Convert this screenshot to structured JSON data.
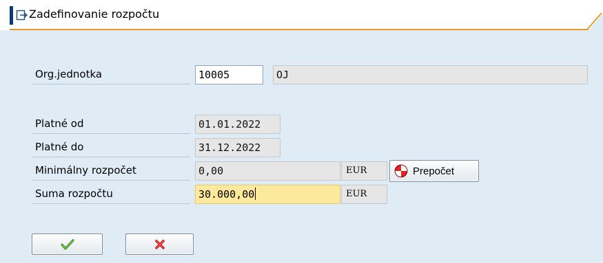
{
  "window": {
    "title": "Zadefinovanie rozpočtu",
    "colors": {
      "title_accent": "#0a3d72",
      "title_underline": "#e59a2c",
      "background": "#dfebf5"
    }
  },
  "form": {
    "org_unit": {
      "label": "Org.jednotka",
      "value": "10005",
      "description": "OJ"
    },
    "valid_from": {
      "label": "Platné od",
      "value": "01.01.2022"
    },
    "valid_to": {
      "label": "Platné do",
      "value": "31.12.2022"
    },
    "min_budget": {
      "label": "Minimálny rozpočet",
      "value": "0,00",
      "currency": "EUR",
      "recalc_label": "Prepočet",
      "recalc_icon": "recalculate-icon"
    },
    "budget_sum": {
      "label": "Suma rozpočtu",
      "value": "30.000,00",
      "currency": "EUR"
    }
  },
  "actions": {
    "confirm_icon": "checkmark-icon",
    "cancel_icon": "cancel-x-icon"
  }
}
